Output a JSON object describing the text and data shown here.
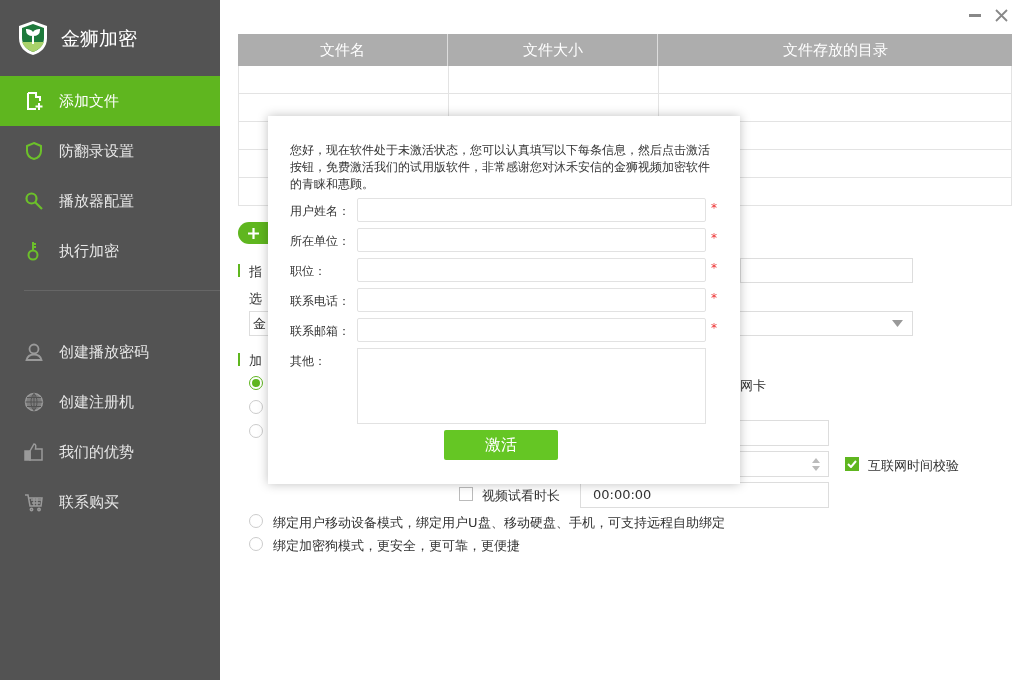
{
  "app": {
    "title": "金狮加密"
  },
  "sidebar": {
    "items": [
      {
        "label": "添加文件",
        "selected": true
      },
      {
        "label": "防翻录设置",
        "selected": false
      },
      {
        "label": "播放器配置",
        "selected": false
      },
      {
        "label": "执行加密",
        "selected": false
      }
    ],
    "more_items": [
      {
        "label": "创建播放密码",
        "selected": false
      },
      {
        "label": "创建注册机",
        "selected": false
      },
      {
        "label": "我们的优势",
        "selected": false
      },
      {
        "label": "联系购买",
        "selected": false
      }
    ]
  },
  "table": {
    "columns": [
      "文件名",
      "文件大小",
      "文件存放的目录"
    ]
  },
  "background": {
    "section_1": "指",
    "select_label": "选",
    "select_value": "金",
    "section_2": "加",
    "radio_1_tail": "网卡",
    "radios": [
      {
        "selected": true
      },
      {
        "selected": false
      },
      {
        "selected": false
      }
    ],
    "internet_check": {
      "label": "互联网时间校验",
      "checked": true
    },
    "trial_check": {
      "label": "视频试看时长",
      "checked": false,
      "value": "00:00:00"
    },
    "bottom_radios": [
      {
        "label": "绑定用户移动设备模式，绑定用户U盘、移动硬盘、手机，可支持远程自助绑定",
        "selected": false
      },
      {
        "label": "绑定加密狗模式，更安全，更可靠，更便捷",
        "selected": false
      }
    ]
  },
  "dialog": {
    "message": "您好，现在软件处于未激活状态，您可以认真填写以下每条信息，然后点击激活按钮，免费激活我们的试用版软件，非常感谢您对沐禾安信的金狮视频加密软件的青睐和惠顾。",
    "fields": [
      {
        "label": "用户姓名：",
        "required": true,
        "kind": "line"
      },
      {
        "label": "所在单位：",
        "required": true,
        "kind": "line"
      },
      {
        "label": "职位：",
        "required": true,
        "kind": "line"
      },
      {
        "label": "联系电话：",
        "required": true,
        "kind": "line"
      },
      {
        "label": "联系邮箱：",
        "required": true,
        "kind": "line"
      },
      {
        "label": "其他：",
        "required": false,
        "kind": "area"
      }
    ],
    "required_mark": "*",
    "button": "激活"
  }
}
